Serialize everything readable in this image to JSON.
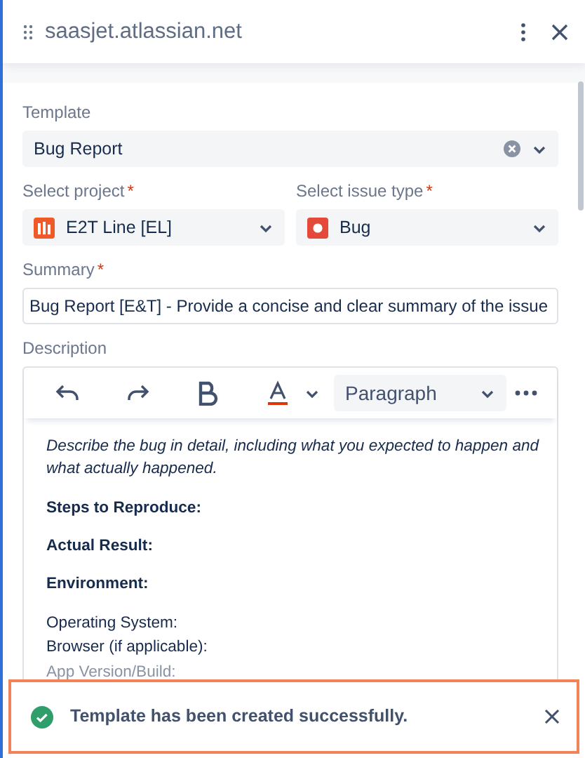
{
  "header": {
    "title": "saasjet.atlassian.net"
  },
  "template": {
    "label": "Template",
    "value": "Bug Report"
  },
  "project": {
    "label": "Select project",
    "required_mark": "*",
    "value": "E2T Line [EL]"
  },
  "issue_type": {
    "label": "Select issue type",
    "required_mark": "*",
    "value": "Bug"
  },
  "summary": {
    "label": "Summary",
    "required_mark": "*",
    "value": "Bug Report [E&T] - Provide a concise and clear summary of the issue"
  },
  "description": {
    "label": "Description",
    "format": "Paragraph",
    "content": [
      {
        "kind": "italic",
        "text": "Describe the bug in detail, including what you expected to happen and what actually happened."
      },
      {
        "kind": "heading",
        "text": "Steps to Reproduce:"
      },
      {
        "kind": "heading",
        "text": "Actual Result:"
      },
      {
        "kind": "heading",
        "text": "Environment:"
      },
      {
        "kind": "line",
        "text": "Operating System:"
      },
      {
        "kind": "line",
        "text": "Browser (if applicable):"
      },
      {
        "kind": "faded",
        "text": "App Version/Build:"
      }
    ]
  },
  "toast": {
    "kind": "success",
    "message": "Template has been created successfully."
  }
}
